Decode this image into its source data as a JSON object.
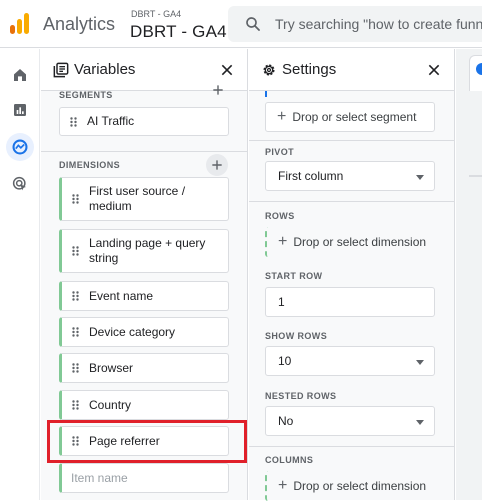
{
  "topbar": {
    "app_name": "Analytics",
    "property_small": "DBRT - GA4",
    "property_main": "DBRT - GA4",
    "search_placeholder": "Try searching \"how to create funnel\""
  },
  "rail": {
    "items": [
      {
        "icon": "home-icon"
      },
      {
        "icon": "reports-icon"
      },
      {
        "icon": "explore-icon",
        "active": true
      },
      {
        "icon": "advertising-icon"
      }
    ]
  },
  "variables_panel": {
    "title": "Variables",
    "segments_label": "SEGMENTS",
    "segments": [
      "AI Traffic"
    ],
    "dimensions_label": "DIMENSIONS",
    "dimensions": [
      "First user source / medium",
      "Landing page + query string",
      "Event name",
      "Device category",
      "Browser",
      "Country",
      "Page referrer"
    ],
    "item_placeholder": "Item name"
  },
  "settings_panel": {
    "title": "Settings",
    "drop_segment": "Drop or select segment",
    "pivot_label": "PIVOT",
    "pivot_value": "First column",
    "rows_label": "ROWS",
    "drop_dimension_rows": "Drop or select dimension",
    "start_row_label": "START ROW",
    "start_row_value": "1",
    "show_rows_label": "SHOW ROWS",
    "show_rows_value": "10",
    "nested_rows_label": "NESTED ROWS",
    "nested_rows_value": "No",
    "columns_label": "COLUMNS",
    "drop_dimension_columns": "Drop or select dimension"
  },
  "colors": {
    "accent": "#1a73e8",
    "dimension_bar": "#81c995",
    "highlight": "#e0202a"
  }
}
